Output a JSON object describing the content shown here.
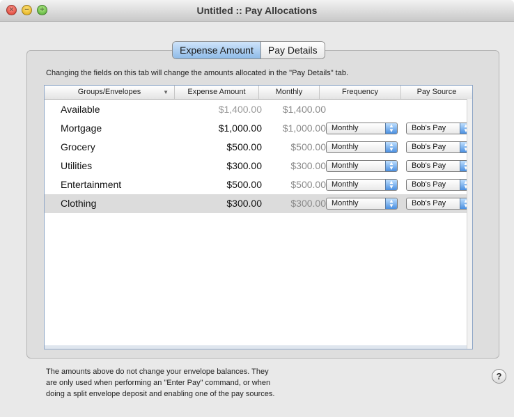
{
  "window": {
    "title": "Untitled :: Pay Allocations",
    "controls": {
      "close_icon": "close-icon",
      "minimize_icon": "minimize-icon",
      "zoom_icon": "zoom-icon"
    }
  },
  "tabs": [
    {
      "label": "Expense Amount",
      "selected": true
    },
    {
      "label": "Pay Details",
      "selected": false
    }
  ],
  "info_text": "Changing the fields on this tab will change the amounts allocated in the \"Pay Details\" tab.",
  "table": {
    "columns": [
      "Groups/Envelopes",
      "Expense Amount",
      "Monthly",
      "Frequency",
      "Pay Source"
    ],
    "sort_indicator": "▼",
    "rows": [
      {
        "name": "Available",
        "expense": "$1,400.00",
        "monthly": "$1,400.00",
        "frequency": "",
        "pay_source": ""
      },
      {
        "name": "Mortgage",
        "expense": "$1,000.00",
        "monthly": "$1,000.00",
        "frequency": "Monthly",
        "pay_source": "Bob's Pay"
      },
      {
        "name": "Grocery",
        "expense": "$500.00",
        "monthly": "$500.00",
        "frequency": "Monthly",
        "pay_source": "Bob's Pay"
      },
      {
        "name": "Utilities",
        "expense": "$300.00",
        "monthly": "$300.00",
        "frequency": "Monthly",
        "pay_source": "Bob's Pay"
      },
      {
        "name": "Entertainment",
        "expense": "$500.00",
        "monthly": "$500.00",
        "frequency": "Monthly",
        "pay_source": "Bob's Pay"
      },
      {
        "name": "Clothing",
        "expense": "$300.00",
        "monthly": "$300.00",
        "frequency": "Monthly",
        "pay_source": "Bob's Pay",
        "selected": true
      }
    ]
  },
  "footnote": {
    "line1": "The amounts above do not change your envelope balances.  They",
    "line2": "are only used when performing an \"Enter Pay\" command, or when",
    "line3": "doing a split envelope deposit and enabling one of the pay sources."
  },
  "help_label": "?",
  "colors": {
    "accent": "#8fbbe8",
    "selected_row": "#dcdcdc",
    "window_bg": "#e9e9e9"
  }
}
